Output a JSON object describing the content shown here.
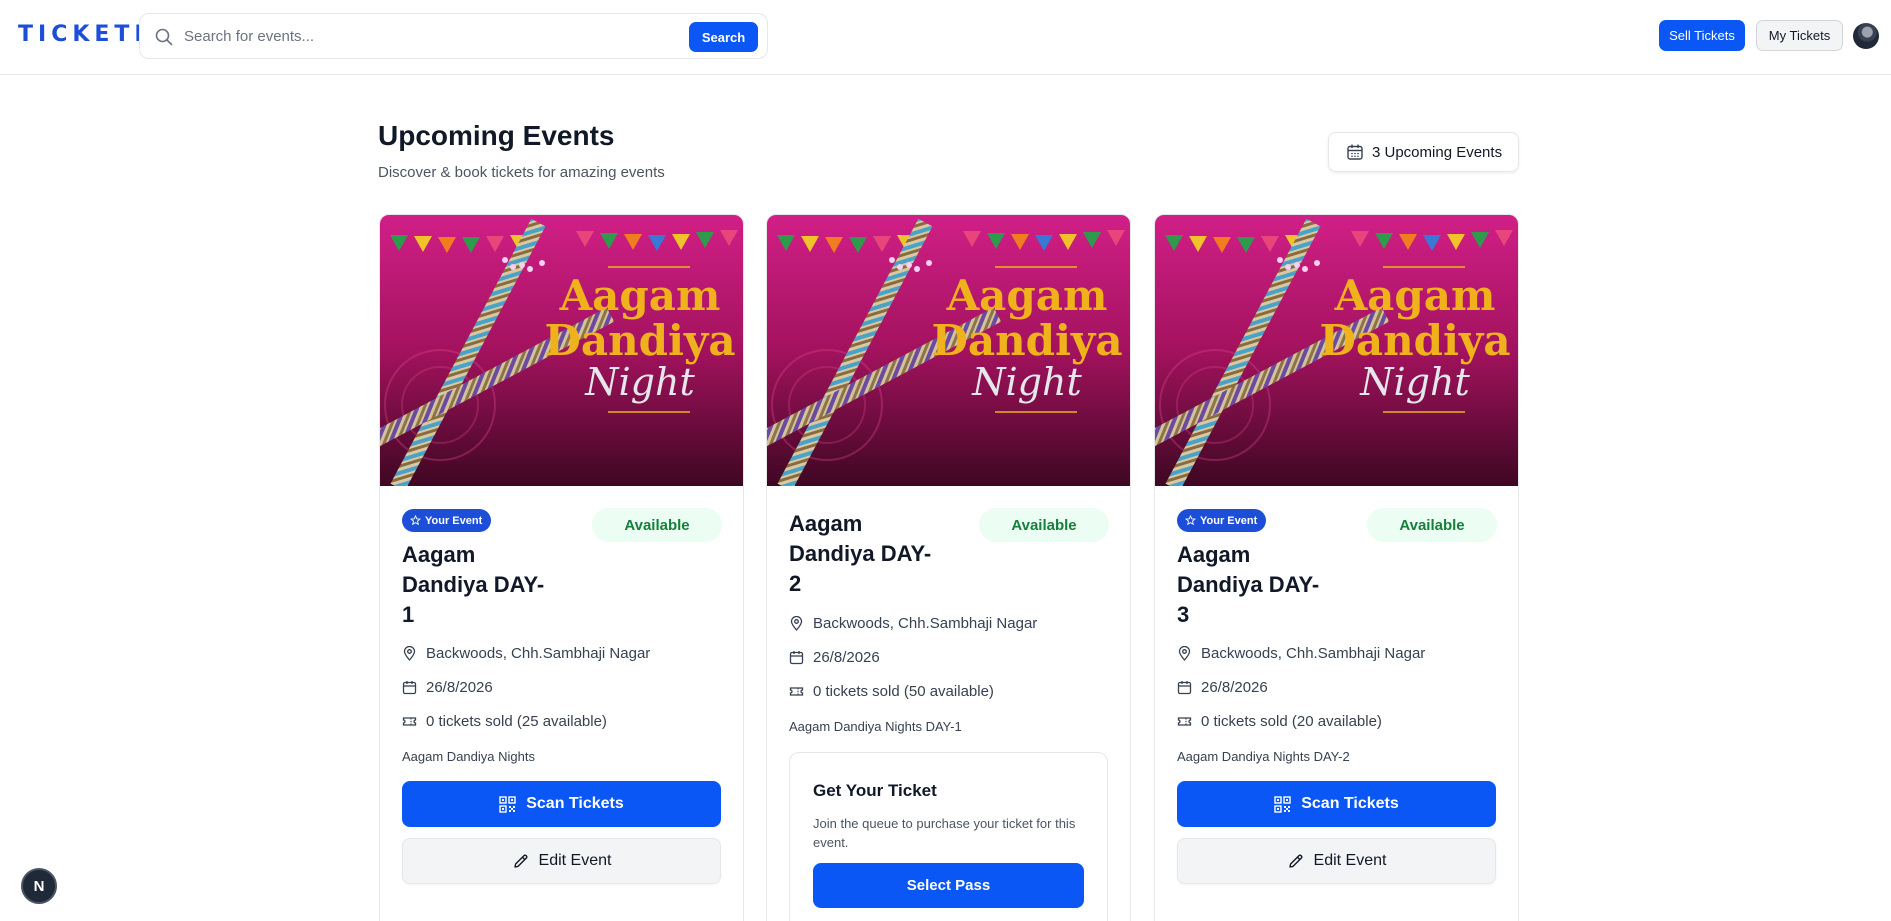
{
  "header": {
    "logo": "TICKETR",
    "search_placeholder": "Search for events...",
    "search_button": "Search",
    "sell_button": "Sell Tickets",
    "my_tickets_button": "My Tickets"
  },
  "page": {
    "title": "Upcoming Events",
    "subtitle": "Discover & book tickets for amazing events",
    "count_label": "3 Upcoming Events"
  },
  "image_text": {
    "line1": "Aagam",
    "line2": "Dandiya",
    "line3": "Night"
  },
  "events": [
    {
      "owner_badge": "Your Event",
      "status": "Available",
      "title_lines": [
        "Aagam",
        "Dandiya DAY-",
        "1"
      ],
      "location": "Backwoods, Chh.Sambhaji Nagar",
      "date": "26/8/2026",
      "tickets": "0 tickets sold (25 available)",
      "description": "Aagam Dandiya Nights",
      "scan_button": "Scan Tickets",
      "edit_button": "Edit Event"
    },
    {
      "status": "Available",
      "title_lines": [
        "Aagam",
        "Dandiya DAY-",
        "2"
      ],
      "location": "Backwoods, Chh.Sambhaji Nagar",
      "date": "26/8/2026",
      "tickets": "0 tickets sold (50 available)",
      "description": "Aagam Dandiya Nights DAY-1",
      "ticket_box_title": "Get Your Ticket",
      "ticket_box_text": "Join the queue to purchase your ticket for this event.",
      "select_button": "Select Pass"
    },
    {
      "owner_badge": "Your Event",
      "status": "Available",
      "title_lines": [
        "Aagam",
        "Dandiya DAY-",
        "3"
      ],
      "location": "Backwoods, Chh.Sambhaji Nagar",
      "date": "26/8/2026",
      "tickets": "0 tickets sold (20 available)",
      "description": "Aagam Dandiya Nights DAY-2",
      "scan_button": "Scan Tickets",
      "edit_button": "Edit Event"
    }
  ],
  "dev_badge": "N",
  "colors": {
    "primary": "#0b57f5",
    "badge_blue": "#1d4ed8",
    "available_bg": "#ecfdf3",
    "available_text": "#15803d",
    "image_magenta": "#c2185b",
    "image_gold": "#f0b21c"
  },
  "icons": [
    "search-icon",
    "calendar-icon",
    "star-icon",
    "map-pin-icon",
    "ticket-icon",
    "qr-code-icon",
    "pencil-icon"
  ]
}
